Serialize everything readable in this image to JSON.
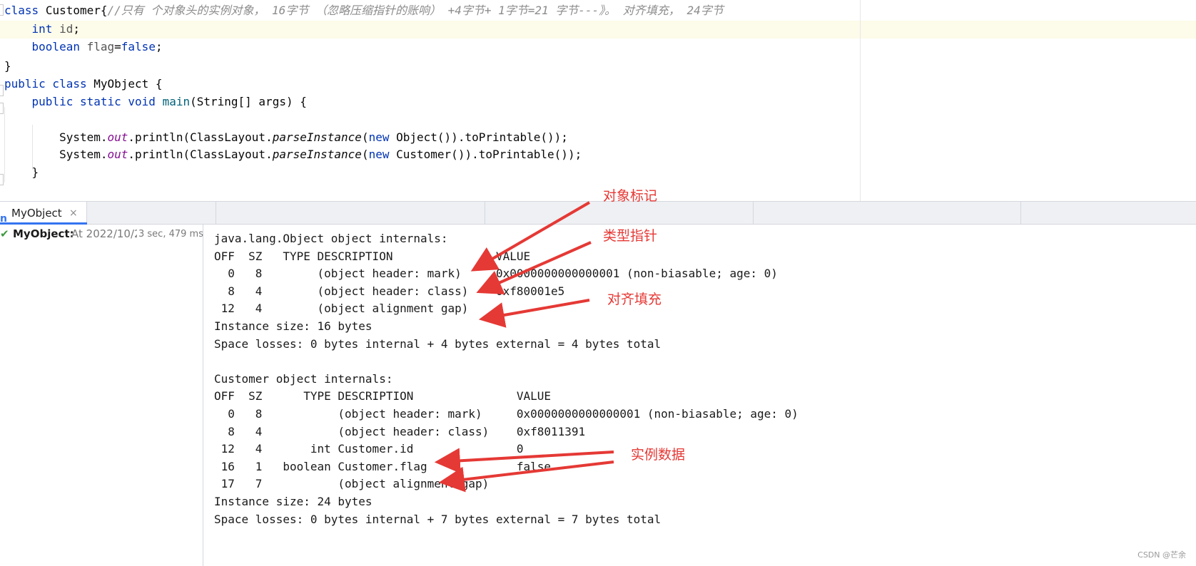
{
  "editor": {
    "lines": [
      {
        "parts": [
          [
            "kw",
            "class"
          ],
          [
            "",
            ""
          ],
          [
            "",
            " "
          ],
          [
            "",
            "Customer{"
          ],
          [
            "cm",
            "//只有 个对象头的实例对象， 16字节 （忽略压缩指针的账响） +4字节+ 1字节=21 字节---》。 对齐填充， 24字节"
          ]
        ]
      },
      {
        "parts": [
          [
            "",
            "    "
          ],
          [
            "kw",
            "int"
          ],
          [
            "",
            " "
          ],
          [
            "id-muted",
            "id"
          ],
          [
            "",
            ";"
          ]
        ]
      },
      {
        "parts": [
          [
            "",
            "    "
          ],
          [
            "kw",
            "boolean"
          ],
          [
            "",
            " "
          ],
          [
            "id-muted",
            "flag"
          ],
          [
            "",
            "="
          ],
          [
            "kw",
            "false"
          ],
          [
            "",
            ";"
          ]
        ]
      },
      {
        "parts": [
          [
            "",
            "}"
          ]
        ]
      },
      {
        "parts": [
          [
            "kw",
            "public class"
          ],
          [
            "",
            " MyObject {"
          ]
        ]
      },
      {
        "parts": [
          [
            "",
            "    "
          ],
          [
            "kw",
            "public static void"
          ],
          [
            "",
            " "
          ],
          [
            "fn",
            "main"
          ],
          [
            "",
            "(String[] args) {"
          ]
        ]
      },
      {
        "parts": [
          [
            "",
            ""
          ]
        ]
      },
      {
        "parts": [
          [
            "",
            "        System."
          ],
          [
            "field ital",
            "out"
          ],
          [
            "",
            ".println(ClassLayout."
          ],
          [
            "ital",
            "parseInstance"
          ],
          [
            "",
            "("
          ],
          [
            "kw",
            "new"
          ],
          [
            "",
            " Object()).toPrintable());"
          ]
        ]
      },
      {
        "parts": [
          [
            "",
            "        System."
          ],
          [
            "field ital",
            "out"
          ],
          [
            "",
            ".println(ClassLayout."
          ],
          [
            "ital",
            "parseInstance"
          ],
          [
            "",
            "("
          ],
          [
            "kw",
            "new"
          ],
          [
            "",
            " Customer()).toPrintable());"
          ]
        ]
      },
      {
        "parts": [
          [
            "",
            "    }"
          ]
        ]
      }
    ]
  },
  "tab": {
    "icon": "run-config-icon",
    "label": "MyObject",
    "close": "×"
  },
  "run": {
    "status_icon": "✔",
    "name": "MyObject:",
    "at": "At 2022/10/2",
    "duration": "3 sec, 479 ms"
  },
  "console": [
    "java.lang.Object object internals:",
    "OFF  SZ   TYPE DESCRIPTION               VALUE",
    "  0   8        (object header: mark)     0x0000000000000001 (non-biasable; age: 0)",
    "  8   4        (object header: class)    0xf80001e5",
    " 12   4        (object alignment gap)",
    "Instance size: 16 bytes",
    "Space losses: 0 bytes internal + 4 bytes external = 4 bytes total",
    "",
    "Customer object internals:",
    "OFF  SZ      TYPE DESCRIPTION               VALUE",
    "  0   8           (object header: mark)     0x0000000000000001 (non-biasable; age: 0)",
    "  8   4           (object header: class)    0xf8011391",
    " 12   4       int Customer.id               0",
    " 16   1   boolean Customer.flag             false",
    " 17   7           (object alignment gap)",
    "Instance size: 24 bytes",
    "Space losses: 0 bytes internal + 7 bytes external = 7 bytes total"
  ],
  "annotations": {
    "mark": "对象标记",
    "klass": "类型指针",
    "padding": "对齐填充",
    "instance": "实例数据"
  },
  "accent_color": "#e53935",
  "watermark": "CSDN @芒余"
}
